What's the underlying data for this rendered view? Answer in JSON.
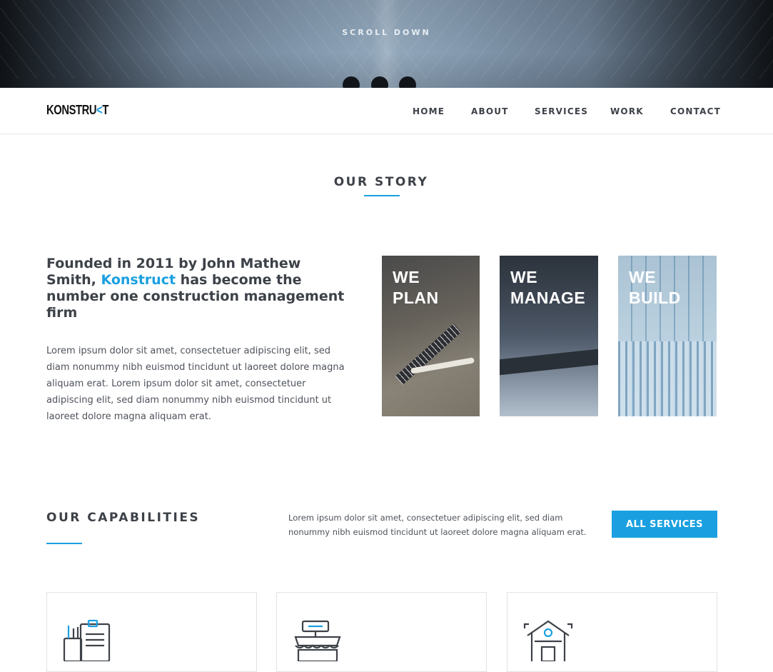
{
  "hero": {
    "scroll_label": "SCROLL DOWN"
  },
  "nav": {
    "logo_main": "KONSTRU",
    "logo_accent": "<",
    "logo_end": "T",
    "links": [
      "HOME",
      "ABOUT",
      "SERVICES",
      "WORK",
      "CONTACT"
    ]
  },
  "story": {
    "title": "OUR STORY",
    "heading_part1": "Founded in 2011 by John Mathew Smith, ",
    "heading_brand": "Konstruct",
    "heading_part2": " has become the number one construction management firm",
    "body": "Lorem ipsum dolor sit amet, consectetuer adipiscing elit, sed diam nonummy nibh euismod tincidunt ut laoreet dolore magna aliquam erat. Lorem ipsum dolor sit amet, consectetuer adipiscing elit, sed diam nonummy nibh euismod tincidunt ut laoreet dolore magna aliquam erat.",
    "cards": [
      {
        "label": "WE\nPLAN"
      },
      {
        "label": "WE\nMANAGE"
      },
      {
        "label": "WE\nBUILD"
      }
    ]
  },
  "capabilities": {
    "title": "OUR CAPABILITIES",
    "text": "Lorem ipsum dolor sit amet, consectetuer adipiscing elit, sed diam nonummy nibh euismod tincidunt ut laoreet dolore magna aliquam erat.",
    "button_label": "ALL SERVICES",
    "service_icons": [
      "clipboard-tools-icon",
      "storefront-icon",
      "house-icon"
    ]
  },
  "colors": {
    "accent": "#1aa0e0",
    "text": "#3d4148"
  }
}
